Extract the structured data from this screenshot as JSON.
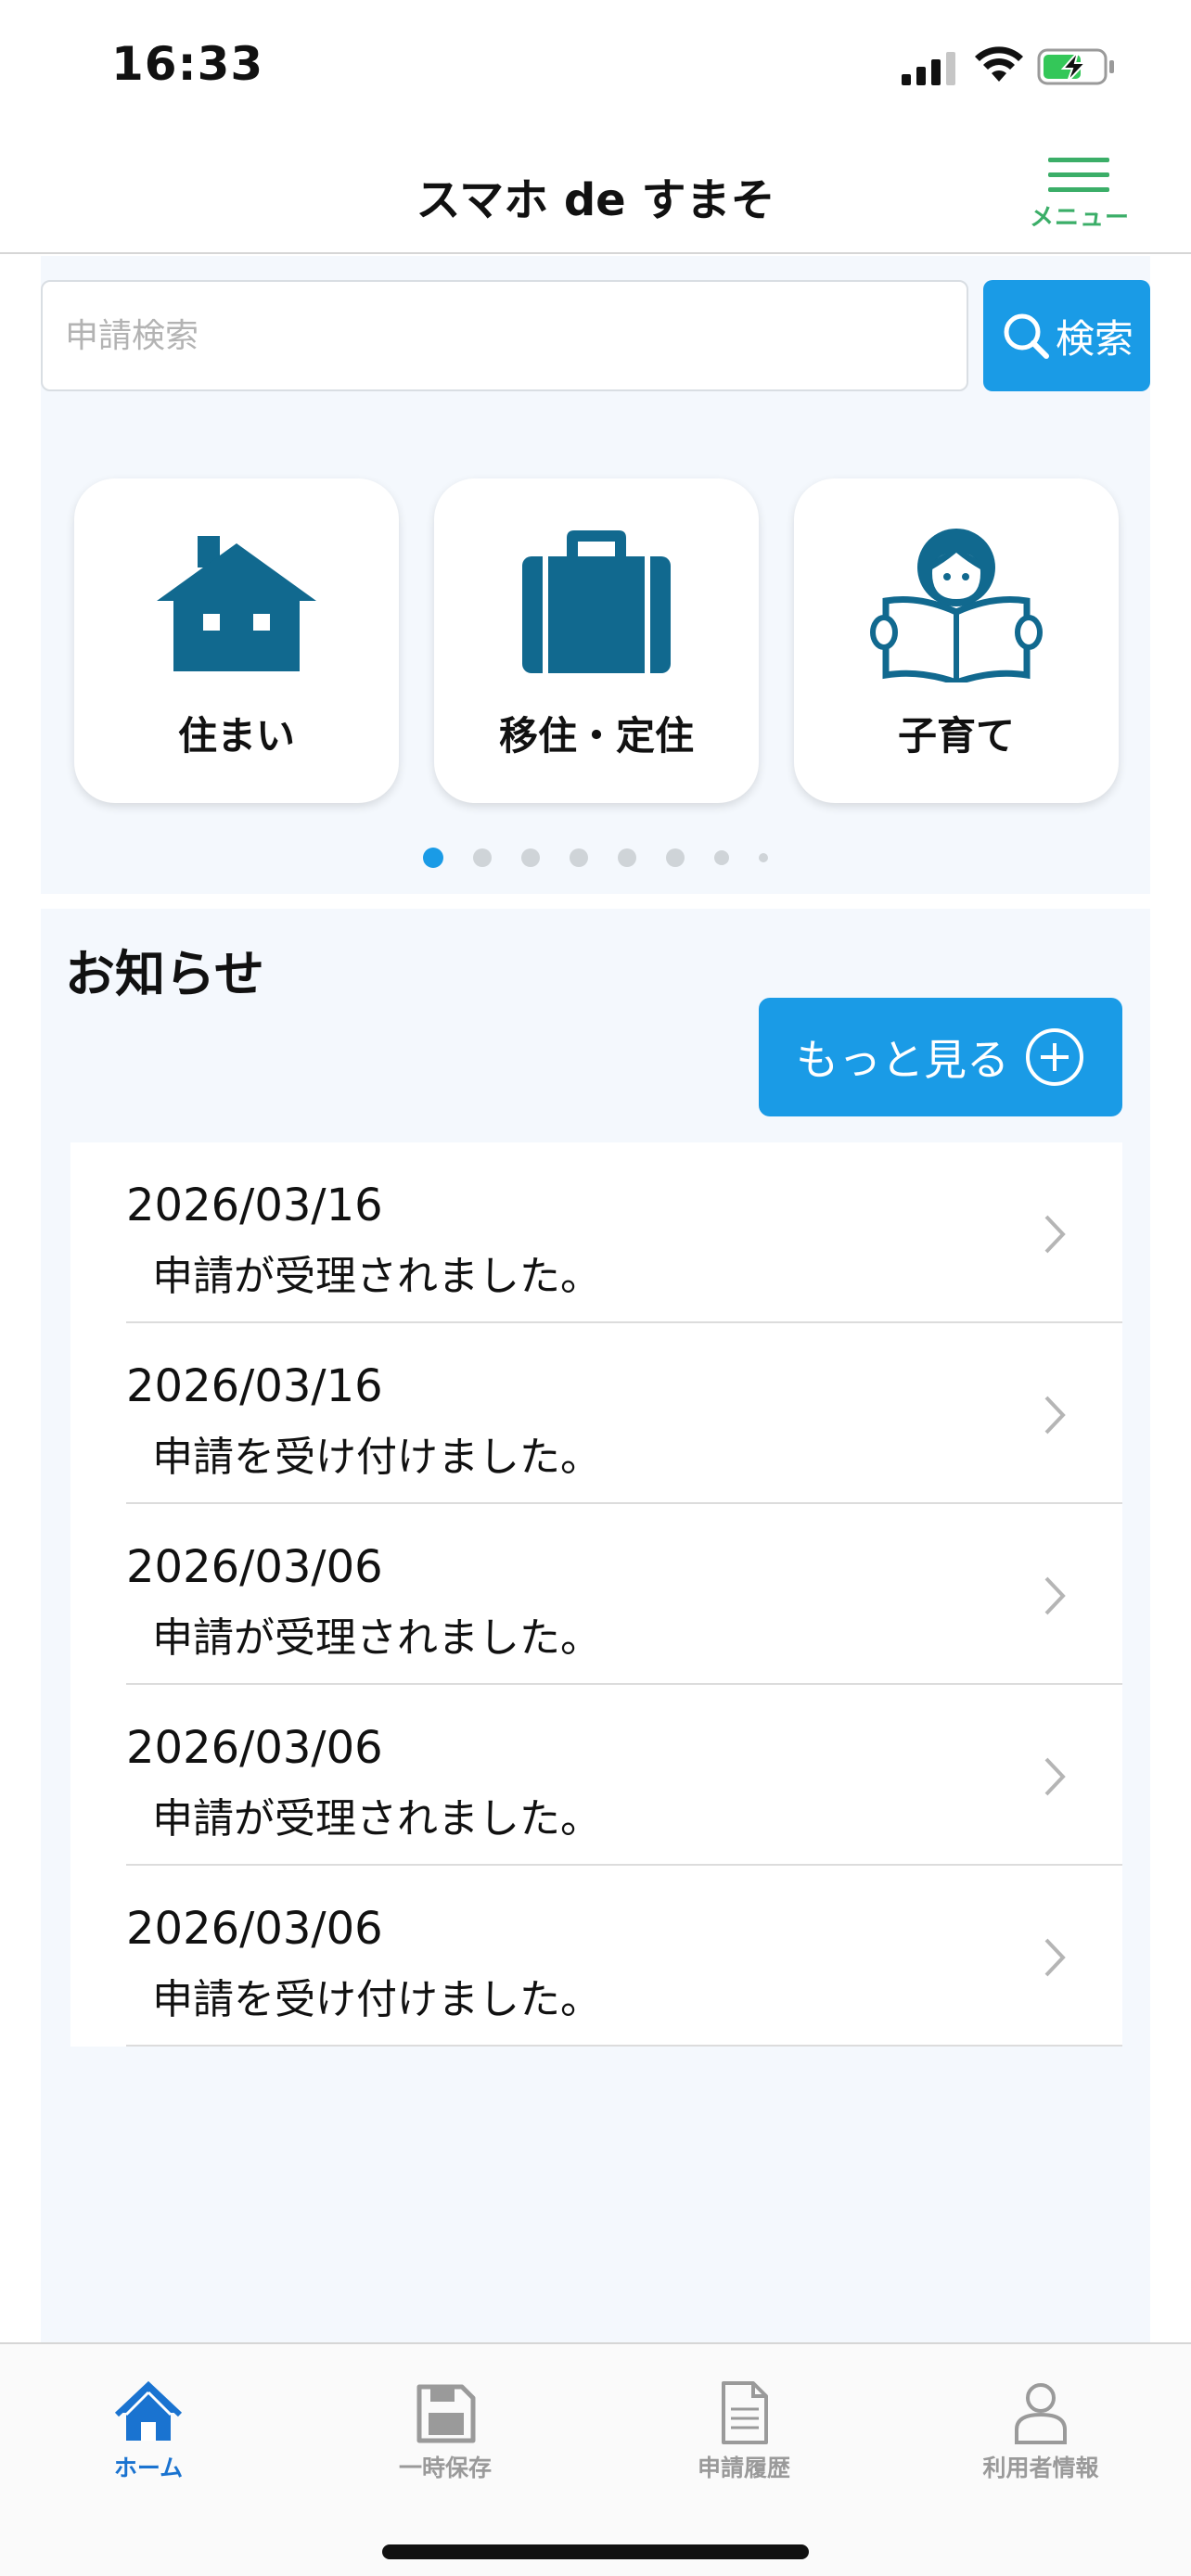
{
  "status_bar": {
    "time": "16:33"
  },
  "header": {
    "title": "スマホ de すまそ",
    "menu_label": "メニュー"
  },
  "search": {
    "placeholder": "申請検索",
    "button_label": "検索"
  },
  "categories": [
    {
      "label": "住まい",
      "icon": "house-icon"
    },
    {
      "label": "移住・定住",
      "icon": "briefcase-icon"
    },
    {
      "label": "子育て",
      "icon": "child-reading-icon"
    }
  ],
  "carousel": {
    "page_count": 8,
    "active_index": 0
  },
  "news": {
    "title": "お知らせ",
    "more_label": "もっと見る",
    "items": [
      {
        "date": "2026/03/16",
        "text": "申請が受理されました。"
      },
      {
        "date": "2026/03/16",
        "text": "申請を受け付けました。"
      },
      {
        "date": "2026/03/06",
        "text": "申請が受理されました。"
      },
      {
        "date": "2026/03/06",
        "text": "申請が受理されました。"
      },
      {
        "date": "2026/03/06",
        "text": "申請を受け付けました。"
      }
    ]
  },
  "tabs": [
    {
      "label": "ホーム",
      "icon": "home-icon",
      "active": true
    },
    {
      "label": "一時保存",
      "icon": "save-icon",
      "active": false
    },
    {
      "label": "申請履歴",
      "icon": "document-icon",
      "active": false
    },
    {
      "label": "利用者情報",
      "icon": "user-icon",
      "active": false
    }
  ],
  "colors": {
    "accent": "#1a9be6",
    "menu_green": "#3bae68",
    "icon_teal": "#11698f",
    "tab_active": "#1a73d0"
  }
}
